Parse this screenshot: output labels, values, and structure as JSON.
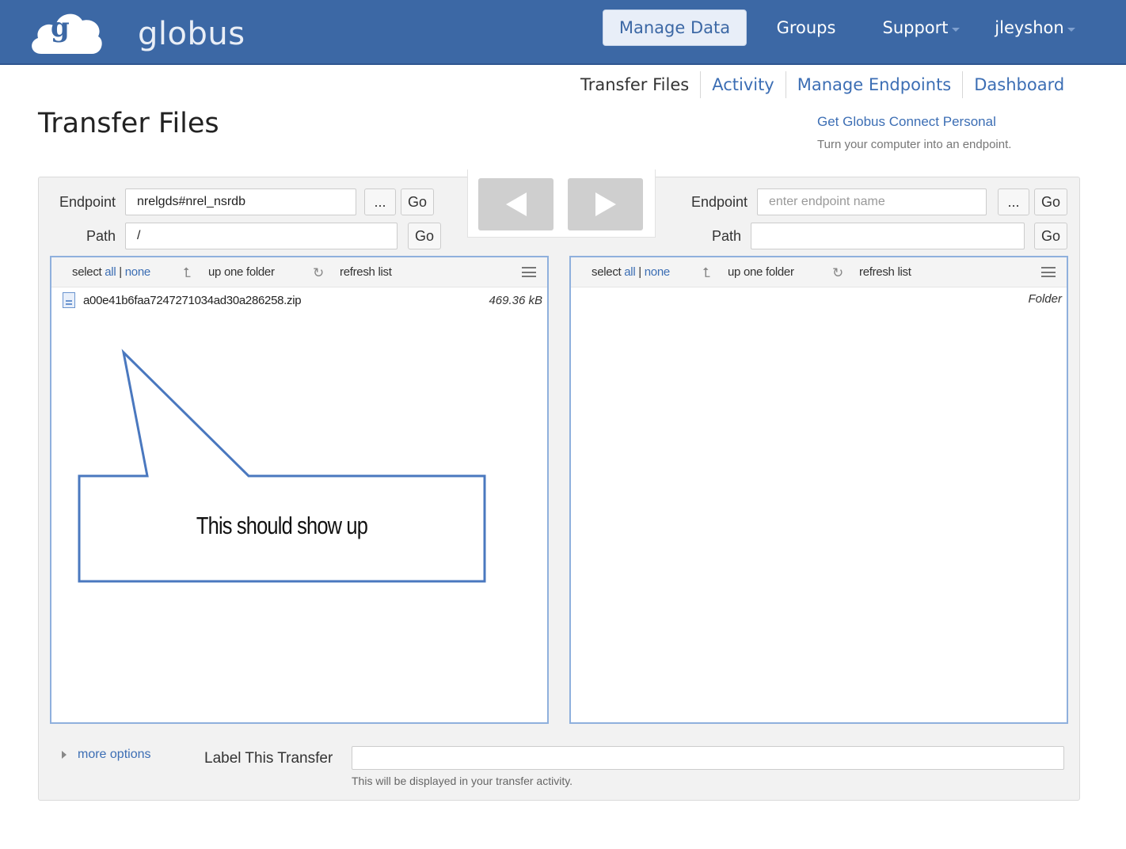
{
  "header": {
    "logo_text": "globus",
    "logo_letter": "g",
    "nav": {
      "manage_data": "Manage Data",
      "groups": "Groups",
      "support": "Support",
      "user": "jleyshon"
    }
  },
  "subnav": {
    "transfer_files": "Transfer Files",
    "activity": "Activity",
    "manage_endpoints": "Manage Endpoints",
    "dashboard": "Dashboard"
  },
  "page": {
    "title": "Transfer Files",
    "gcp_link": "Get Globus Connect Personal",
    "gcp_sub": "Turn your computer into an endpoint."
  },
  "left": {
    "endpoint_label": "Endpoint",
    "endpoint_value": "nrelgds#nrel_nsrdb",
    "browse_label": "...",
    "go_label": "Go",
    "path_label": "Path",
    "path_value": "/",
    "path_go_label": "Go",
    "toolbar": {
      "select": "select",
      "all": "all",
      "sep": "|",
      "none": "none",
      "up": "up one folder",
      "refresh": "refresh list"
    },
    "files": [
      {
        "name": "a00e41b6faa7247271034ad30a286258.zip",
        "size": "469.36 kB"
      }
    ]
  },
  "right": {
    "endpoint_label": "Endpoint",
    "endpoint_placeholder": "enter endpoint name",
    "browse_label": "...",
    "go_label": "Go",
    "path_label": "Path",
    "path_value": "",
    "path_go_label": "Go",
    "toolbar": {
      "select": "select",
      "all": "all",
      "sep": "|",
      "none": "none",
      "up": "up one folder",
      "refresh": "refresh list"
    },
    "folder_header": "Folder"
  },
  "callout": {
    "text": "This should show up"
  },
  "bottom": {
    "more_options": "more options",
    "label_transfer": "Label This Transfer",
    "label_help": "This will be displayed in your transfer activity."
  },
  "colors": {
    "header_bg": "#3c68a5",
    "link": "#3c6eb4",
    "list_border": "#8fb0dd",
    "callout_stroke": "#4a78bf"
  },
  "icons": [
    "globus-cloud-logo",
    "chevron-down-icon",
    "arrow-left-icon",
    "arrow-right-icon",
    "up-folder-icon",
    "refresh-icon",
    "menu-icon",
    "file-icon",
    "triangle-right-icon"
  ]
}
